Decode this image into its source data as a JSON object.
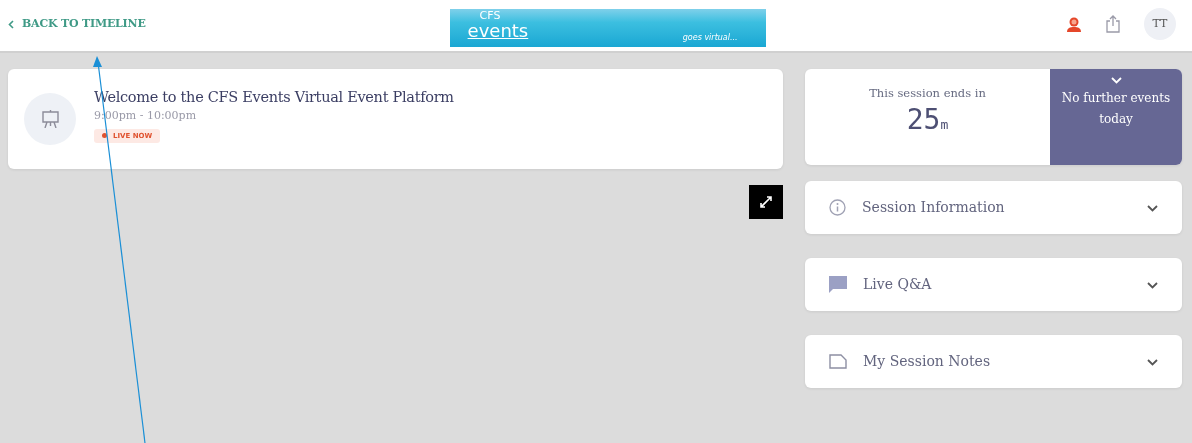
{
  "header": {
    "back_link": "BACK TO TIMELINE",
    "logo": {
      "line_1": "CFS",
      "line_2": "events",
      "tagline": "goes virtual..."
    },
    "avatar": "TT"
  },
  "session": {
    "title": "Welcome to the CFS Events Virtual Event Platform",
    "time": "9:00pm - 10:00pm",
    "status": "LIVE NOW"
  },
  "timer": {
    "label": "This session ends in",
    "value": "25",
    "unit": "m",
    "next": "No further events today"
  },
  "panels": [
    {
      "kind": "info",
      "label": "Session Information",
      "expanded": false
    },
    {
      "kind": "chat",
      "label": "Live Q&A",
      "expanded": false
    },
    {
      "kind": "notes",
      "label": "My Session Notes",
      "expanded": false
    }
  ]
}
